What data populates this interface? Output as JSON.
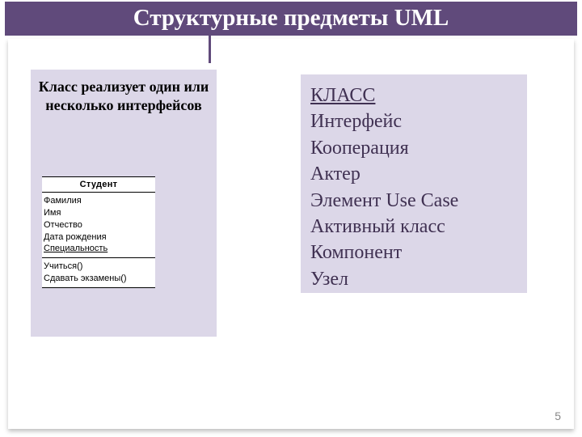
{
  "title": "Структурные предметы UML",
  "left": {
    "caption": "Класс реализует один или несколько интерфейсов",
    "uml": {
      "name": "Студент",
      "attributes": [
        "Фамилия",
        "Имя",
        "Отчество",
        "Дата рождения",
        "Специальность"
      ],
      "operations": [
        "Учиться()",
        "Сдавать экзамены()"
      ]
    }
  },
  "right": {
    "items": [
      "КЛАСС",
      "Интерфейс",
      "Кооперация",
      "Актер",
      "Элемент Use Case",
      "Активный класс",
      "Компонент",
      "Узел"
    ]
  },
  "page_number": "5"
}
